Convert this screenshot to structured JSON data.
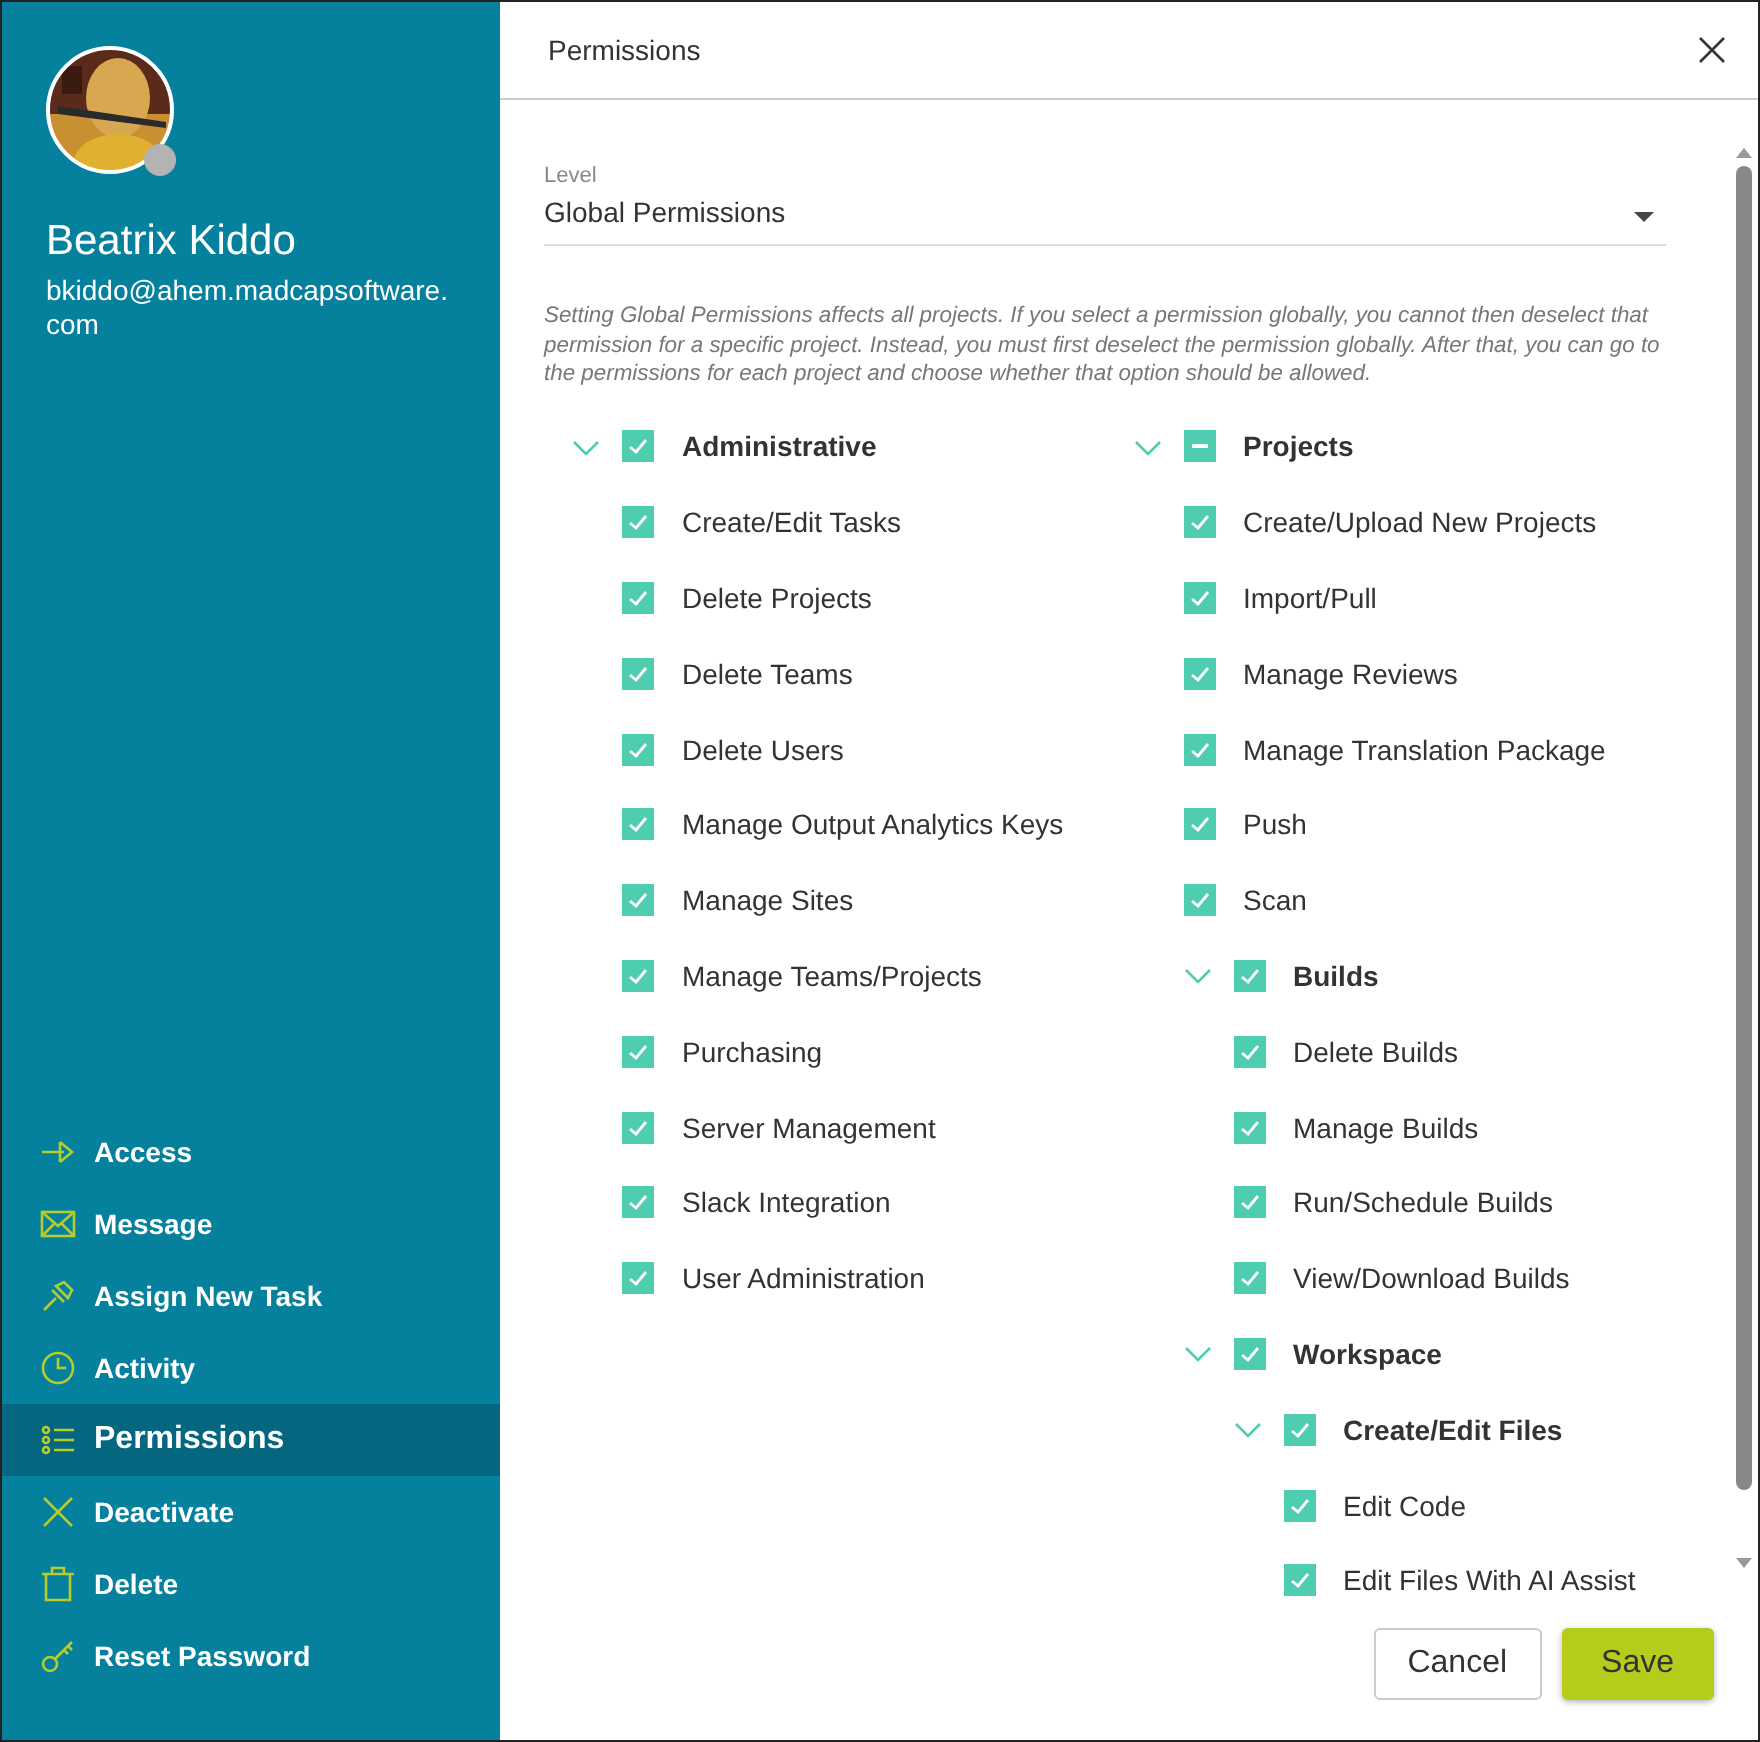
{
  "user": {
    "name": "Beatrix Kiddo",
    "email": "bkiddo@ahem.madcapsoftware.com"
  },
  "menu": [
    {
      "label": "Access",
      "selected": false
    },
    {
      "label": "Message",
      "selected": false
    },
    {
      "label": "Assign New Task",
      "selected": false
    },
    {
      "label": "Activity",
      "selected": false
    },
    {
      "label": "Permissions",
      "selected": true
    },
    {
      "label": "Deactivate",
      "selected": false
    },
    {
      "label": "Delete",
      "selected": false
    },
    {
      "label": "Reset Password",
      "selected": false
    }
  ],
  "dialog": {
    "tab": "Permissions",
    "level": {
      "label": "Level",
      "value": "Global Permissions"
    },
    "note": "Setting Global Permissions affects all projects. If you select a permission globally, you cannot then deselect that permission for a specific project. Instead, you must first deselect the permission globally. After that, you can go to the permissions for each project and choose whether that option should be allowed.",
    "columns": [
      [
        {
          "label": "Administrative",
          "checked": true,
          "indeterminate": false,
          "expanded": true,
          "children": [
            {
              "label": "Create/Edit Tasks",
              "checked": true
            },
            {
              "label": "Delete Projects",
              "checked": true
            },
            {
              "label": "Delete Teams",
              "checked": true
            },
            {
              "label": "Delete Users",
              "checked": true
            },
            {
              "label": "Manage Output Analytics Keys",
              "checked": true
            },
            {
              "label": "Manage Sites",
              "checked": true
            },
            {
              "label": "Manage Teams/Projects",
              "checked": true
            },
            {
              "label": "Purchasing",
              "checked": true
            },
            {
              "label": "Server Management",
              "checked": true
            },
            {
              "label": "Slack Integration",
              "checked": true
            },
            {
              "label": "User Administration",
              "checked": true
            }
          ]
        }
      ],
      [
        {
          "label": "Projects",
          "checked": false,
          "indeterminate": true,
          "expanded": true,
          "children": [
            {
              "label": "Create/Upload New Projects",
              "checked": true
            },
            {
              "label": "Import/Pull",
              "checked": true
            },
            {
              "label": "Manage Reviews",
              "checked": true
            },
            {
              "label": "Manage Translation Package",
              "checked": true
            },
            {
              "label": "Push",
              "checked": true
            },
            {
              "label": "Scan",
              "checked": true
            },
            {
              "label": "Builds",
              "checked": true,
              "expanded": true,
              "children": [
                {
                  "label": "Delete Builds",
                  "checked": true
                },
                {
                  "label": "Manage Builds",
                  "checked": true
                },
                {
                  "label": "Run/Schedule Builds",
                  "checked": true
                },
                {
                  "label": "View/Download Builds",
                  "checked": true
                }
              ]
            },
            {
              "label": "Workspace",
              "checked": true,
              "expanded": true,
              "children": [
                {
                  "label": "Create/Edit Files",
                  "checked": true,
                  "expanded": true,
                  "children": [
                    {
                      "label": "Edit Code",
                      "checked": true
                    },
                    {
                      "label": "Edit Files With AI Assist",
                      "checked": true
                    }
                  ]
                }
              ]
            }
          ]
        }
      ]
    ],
    "buttons": [
      {
        "label": "Cancel",
        "kind": "secondary"
      },
      {
        "label": "Save",
        "kind": "primary"
      }
    ]
  }
}
